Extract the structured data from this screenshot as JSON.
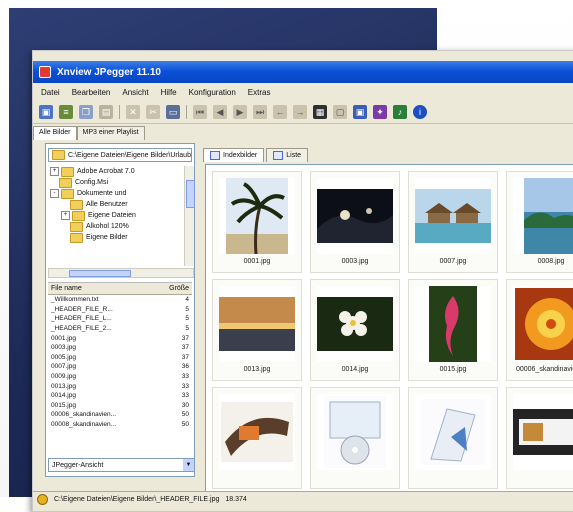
{
  "window": {
    "title": "Xnview JPegger 11.10"
  },
  "menu": [
    "Datei",
    "Bearbeiten",
    "Ansicht",
    "Hilfe",
    "Konfiguration",
    "Extras"
  ],
  "toolbar_icons": [
    "open-icon",
    "scan-icon",
    "copy-icon",
    "paste-icon",
    "delete-icon",
    "cut-icon",
    "info-icon",
    "monitor-icon",
    "rotate-left-icon",
    "first-icon",
    "prev-icon",
    "next-icon",
    "last-icon",
    "back-icon",
    "forward-icon",
    "print-icon",
    "slideshow-icon",
    "view-icon",
    "settings-icon",
    "help-icon"
  ],
  "left_tabs": [
    "Alle Bilder",
    "MP3 einer Playlist"
  ],
  "path": "C:\\Eigene Dateien\\Eigene Bilder\\Urlaub",
  "tree": [
    {
      "label": "Adobe Acrobat 7.0",
      "indent": 1,
      "expand": "+"
    },
    {
      "label": "Config.Msi",
      "indent": 1,
      "expand": ""
    },
    {
      "label": "Dokumente und",
      "indent": 1,
      "expand": "-"
    },
    {
      "label": "Alle Benutzer",
      "indent": 2,
      "expand": ""
    },
    {
      "label": "Eigene Dateien",
      "indent": 2,
      "expand": "+"
    },
    {
      "label": "Alkohol 120%",
      "indent": 2,
      "expand": ""
    },
    {
      "label": "Eigene Bilder",
      "indent": 2,
      "expand": ""
    }
  ],
  "filelist": {
    "header_name": "File name",
    "header_size": "Größe",
    "rows": [
      {
        "name": "_Willkommen.txt",
        "size": "4"
      },
      {
        "name": "_HEADER_FILE_R...",
        "size": "5"
      },
      {
        "name": "_HEADER_FILE_L...",
        "size": "5"
      },
      {
        "name": "_HEADER_FILE_2...",
        "size": "5"
      },
      {
        "name": "0001.jpg",
        "size": "37"
      },
      {
        "name": "0003.jpg",
        "size": "37"
      },
      {
        "name": "0005.jpg",
        "size": "37"
      },
      {
        "name": "0007.jpg",
        "size": "36"
      },
      {
        "name": "0009.jpg",
        "size": "33"
      },
      {
        "name": "0013.jpg",
        "size": "33"
      },
      {
        "name": "0014.jpg",
        "size": "33"
      },
      {
        "name": "0015.jpg",
        "size": "30"
      },
      {
        "name": "00006_skandinavien...",
        "size": "50"
      },
      {
        "name": "00008_skandinavien...",
        "size": "50"
      }
    ]
  },
  "combo_value": "JPegger-Ansicht",
  "right_tabs": [
    "Indexbilder",
    "Liste"
  ],
  "thumbnails": [
    {
      "caption": "0001.jpg",
      "scene": "palm"
    },
    {
      "caption": "0003.jpg",
      "scene": "night"
    },
    {
      "caption": "0007.jpg",
      "scene": "bungalow"
    },
    {
      "caption": "0008.jpg",
      "scene": "island"
    },
    {
      "caption": "0013.jpg",
      "scene": "sunset"
    },
    {
      "caption": "0014.jpg",
      "scene": "flower"
    },
    {
      "caption": "0015.jpg",
      "scene": "ginger"
    },
    {
      "caption": "00006_skandinavien...",
      "scene": "orange"
    },
    {
      "caption": "",
      "scene": "film"
    },
    {
      "caption": "",
      "scene": "cd"
    },
    {
      "caption": "",
      "scene": "box"
    },
    {
      "caption": "",
      "scene": "card"
    }
  ],
  "status": {
    "path": "C:\\Eigene Dateien\\Eigene Bilder\\_HEADER_FILE.jpg",
    "size": "18.374"
  },
  "colors": {
    "background_panel": "#1e2a56",
    "titlebar": "#0a52d8",
    "selection": "#316ac5"
  }
}
